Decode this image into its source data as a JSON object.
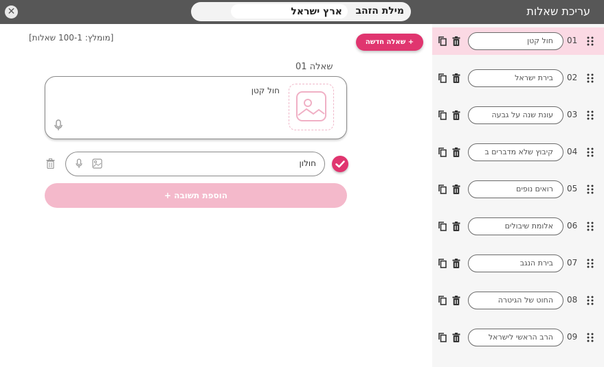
{
  "header": {
    "title": "עריכת שאלות",
    "word_label": "מילת הזהב",
    "word_value": "ארץ ישראל"
  },
  "sidebar": {
    "items": [
      {
        "num": "01",
        "text": "חול קטן",
        "active": true
      },
      {
        "num": "02",
        "text": "בירת ישראל",
        "active": false
      },
      {
        "num": "03",
        "text": "עונת שנה על גבעה",
        "active": false
      },
      {
        "num": "04",
        "text": "קיבוץ שלא מדברים ב",
        "active": false
      },
      {
        "num": "05",
        "text": "רואים נופים",
        "active": false
      },
      {
        "num": "06",
        "text": "אלומת שיבולים",
        "active": false
      },
      {
        "num": "07",
        "text": "בירת הנגב",
        "active": false
      },
      {
        "num": "08",
        "text": "החוט של הגיטרה",
        "active": false
      },
      {
        "num": "09",
        "text": "הרב הראשי לישראל",
        "active": false
      }
    ]
  },
  "main": {
    "new_question_label": "+ שאלה חדשה",
    "hint": "[מומלץ: 100-1 שאלות]",
    "question_heading": "שאלה 01",
    "question_text": "חול קטן",
    "answer_text": "חולון",
    "add_answer_label": "הוספת תשובה +"
  },
  "colors": {
    "accent": "#e0356f",
    "active_row": "#fbd9e4",
    "topbar": "#575757"
  }
}
